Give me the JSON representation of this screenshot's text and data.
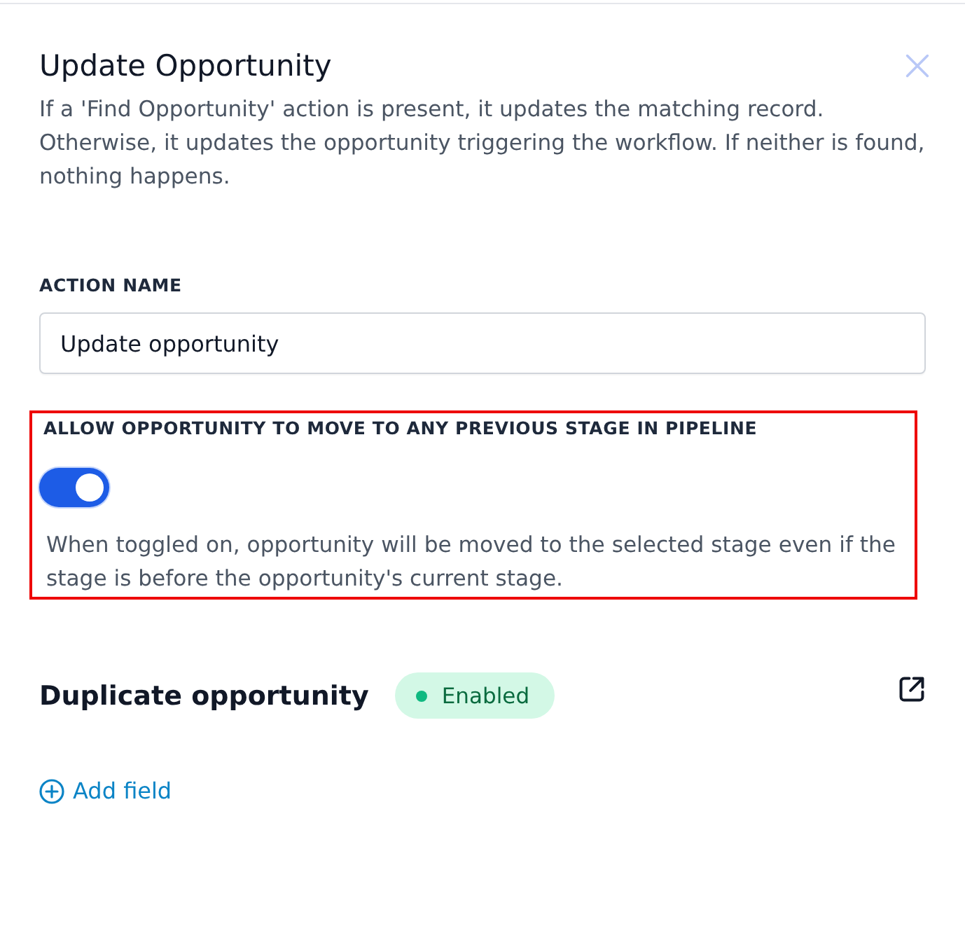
{
  "panel": {
    "title": "Update Opportunity",
    "description": "If a 'Find Opportunity' action is present, it updates the matching record. Otherwise, it updates the opportunity triggering the workflow. If neither is found, nothing happens."
  },
  "action_name": {
    "label": "ACTION NAME",
    "value": "Update opportunity"
  },
  "setting": {
    "label": "ALLOW OPPORTUNITY TO MOVE TO ANY PREVIOUS STAGE IN PIPELINE",
    "on": true,
    "highlighted": true,
    "help": "When toggled on, opportunity will be moved to the selected stage even if the stage is before the opportunity's current stage."
  },
  "section": {
    "title": "Duplicate opportunity",
    "badge": {
      "label": "Enabled",
      "kind": "success"
    }
  },
  "add_field": {
    "label": "Add field"
  }
}
